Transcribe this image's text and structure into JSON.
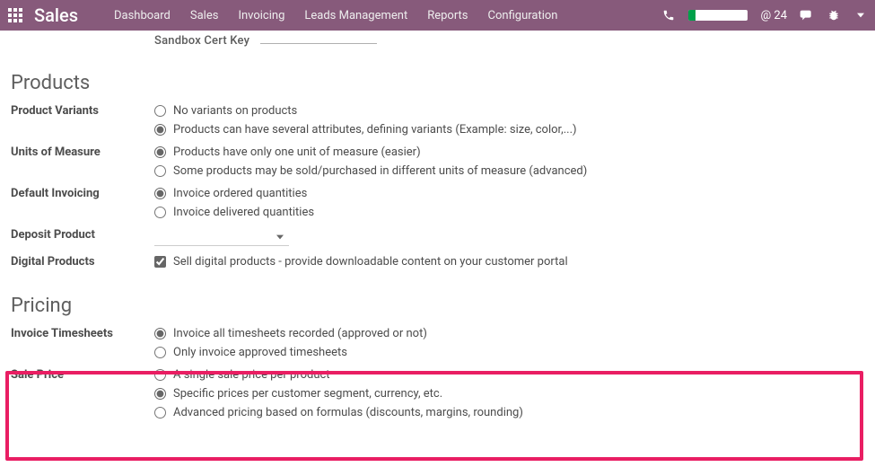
{
  "topbar": {
    "brand": "Sales",
    "menu": [
      "Dashboard",
      "Sales",
      "Invoicing",
      "Leads Management",
      "Reports",
      "Configuration"
    ],
    "messages": "@ 24"
  },
  "cut": {
    "label": "Sandbox Cert Key"
  },
  "sections": {
    "products": {
      "title": "Products",
      "variants": {
        "label": "Product Variants",
        "opt1": "No variants on products",
        "opt2": "Products can have several attributes, defining variants (Example: size, color,...)"
      },
      "uom": {
        "label": "Units of Measure",
        "opt1": "Products have only one unit of measure (easier)",
        "opt2": "Some products may be sold/purchased in different units of measure (advanced)"
      },
      "invoicing": {
        "label": "Default Invoicing",
        "opt1": "Invoice ordered quantities",
        "opt2": "Invoice delivered quantities"
      },
      "deposit": {
        "label": "Deposit Product"
      },
      "digital": {
        "label": "Digital Products",
        "opt1": "Sell digital products - provide downloadable content on your customer portal"
      }
    },
    "pricing": {
      "title": "Pricing",
      "invoice_ts": {
        "label": "Invoice Timesheets",
        "opt1": "Invoice all timesheets recorded (approved or not)",
        "opt2": "Only invoice approved timesheets"
      },
      "sale_price": {
        "label": "Sale Price",
        "opt1": "A single sale price per product",
        "opt2": "Specific prices per customer segment, currency, etc.",
        "opt3": "Advanced pricing based on formulas (discounts, margins, rounding)"
      }
    }
  }
}
